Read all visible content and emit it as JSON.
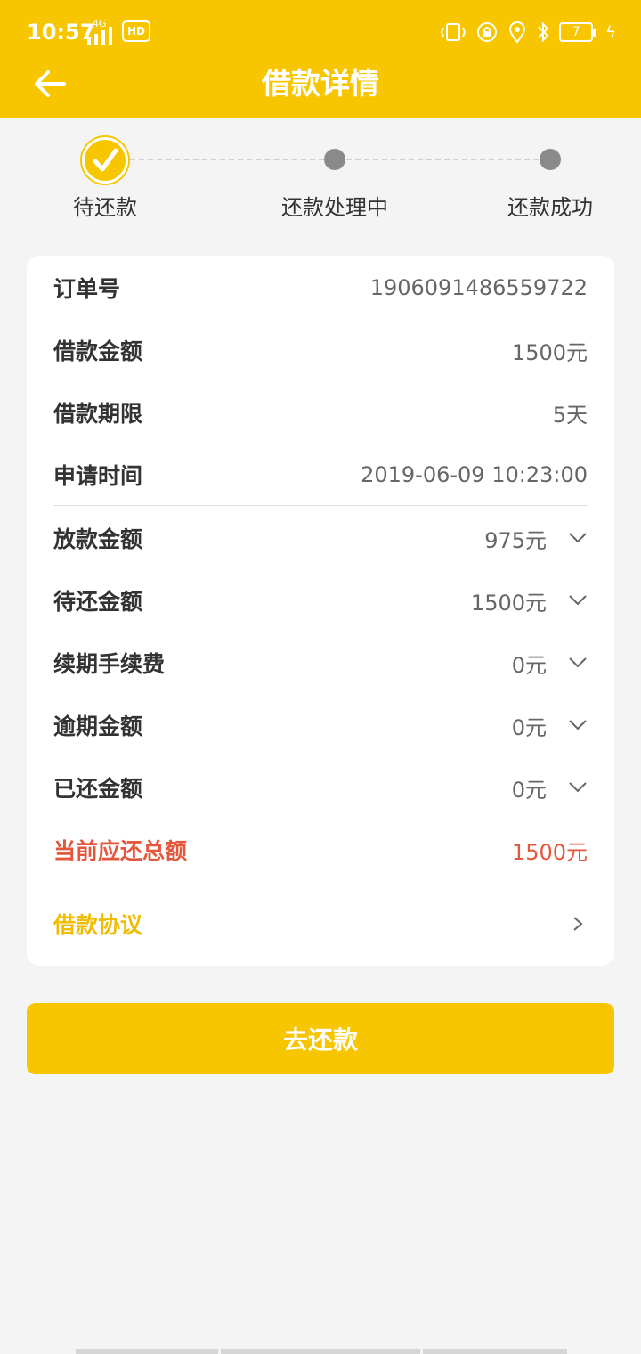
{
  "status_bar": {
    "time": "10:57",
    "network": "4G",
    "hd": "HD",
    "battery": "7"
  },
  "nav": {
    "title": "借款详情"
  },
  "steps": [
    {
      "label": "待还款",
      "state": "done"
    },
    {
      "label": "还款处理中",
      "state": "pending"
    },
    {
      "label": "还款成功",
      "state": "pending"
    }
  ],
  "details": {
    "order_no_label": "订单号",
    "order_no_value": "1906091486559722",
    "loan_amount_label": "借款金额",
    "loan_amount_value": "1500元",
    "loan_term_label": "借款期限",
    "loan_term_value": "5天",
    "apply_time_label": "申请时间",
    "apply_time_value": "2019-06-09 10:23:00",
    "disbursed_label": "放款金额",
    "disbursed_value": "975元",
    "to_repay_label": "待还金额",
    "to_repay_value": "1500元",
    "renewal_fee_label": "续期手续费",
    "renewal_fee_value": "0元",
    "overdue_label": "逾期金额",
    "overdue_value": "0元",
    "repaid_label": "已还金额",
    "repaid_value": "0元",
    "total_due_label": "当前应还总额",
    "total_due_value": "1500元",
    "agreement_label": "借款协议"
  },
  "action": {
    "repay_label": "去还款"
  },
  "colors": {
    "brand": "#f7c600",
    "alert": "#e5573d",
    "step_gray": "#8a8a8a"
  }
}
